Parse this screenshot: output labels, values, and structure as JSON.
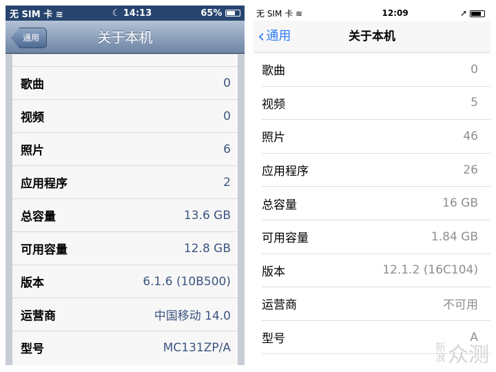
{
  "left": {
    "status": {
      "carrier": "无 SIM 卡",
      "time": "14:13",
      "battery": "65%",
      "battery_level": 0.65
    },
    "nav": {
      "back": "通用",
      "title": "关于本机"
    },
    "rows": [
      {
        "label": "歌曲",
        "value": "0"
      },
      {
        "label": "视频",
        "value": "0"
      },
      {
        "label": "照片",
        "value": "6"
      },
      {
        "label": "应用程序",
        "value": "2"
      },
      {
        "label": "总容量",
        "value": "13.6 GB"
      },
      {
        "label": "可用容量",
        "value": "12.8 GB"
      },
      {
        "label": "版本",
        "value": "6.1.6 (10B500)"
      },
      {
        "label": "运营商",
        "value": "中国移动 14.0"
      },
      {
        "label": "型号",
        "value": "MC131ZP/A"
      }
    ]
  },
  "right": {
    "status": {
      "carrier": "无 SIM 卡",
      "time": "12:09",
      "battery_level": 0.8
    },
    "nav": {
      "back": "通用",
      "title": "关于本机"
    },
    "rows": [
      {
        "label": "歌曲",
        "value": "0"
      },
      {
        "label": "视频",
        "value": "5"
      },
      {
        "label": "照片",
        "value": "46"
      },
      {
        "label": "应用程序",
        "value": "26"
      },
      {
        "label": "总容量",
        "value": "16 GB"
      },
      {
        "label": "可用容量",
        "value": "1.84 GB"
      },
      {
        "label": "版本",
        "value": "12.1.2 (16C104)"
      },
      {
        "label": "运营商",
        "value": "不可用"
      },
      {
        "label": "型号",
        "value": "A"
      }
    ]
  },
  "watermark": "新浪众测",
  "colors": {
    "ios6_nav": "#6d84a3",
    "ios12_accent": "#2f7cf6"
  }
}
